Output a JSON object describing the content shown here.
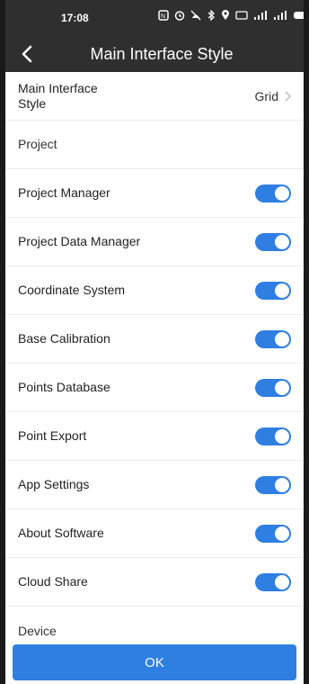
{
  "status": {
    "time": "17:08"
  },
  "header": {
    "title": "Main Interface Style"
  },
  "style_row": {
    "label": "Main Interface Style",
    "value": "Grid"
  },
  "sections": {
    "project": "Project",
    "device": "Device"
  },
  "items": [
    {
      "label": "Project Manager",
      "enabled": true
    },
    {
      "label": "Project Data Manager",
      "enabled": true
    },
    {
      "label": "Coordinate System",
      "enabled": true
    },
    {
      "label": "Base Calibration",
      "enabled": true
    },
    {
      "label": "Points Database",
      "enabled": true
    },
    {
      "label": "Point Export",
      "enabled": true
    },
    {
      "label": "App Settings",
      "enabled": true
    },
    {
      "label": "About Software",
      "enabled": true
    },
    {
      "label": "Cloud Share",
      "enabled": true
    }
  ],
  "ok_label": "OK",
  "colors": {
    "accent": "#2f7fe3",
    "topbar": "#2f2f2f"
  }
}
